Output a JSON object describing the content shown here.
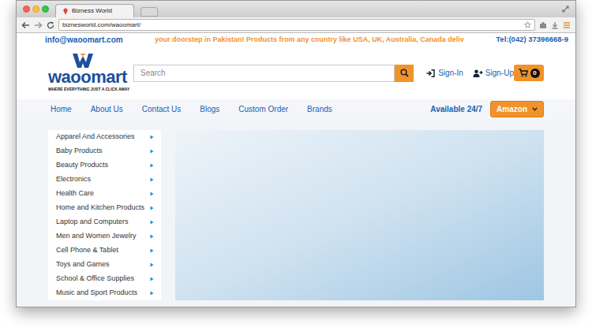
{
  "window": {
    "tab_title": "Bizness World",
    "url": "biznesworld.com/waoomart/"
  },
  "topbar": {
    "email": "info@waoomart.com",
    "marquee": "your doorstep in Pakistan! Products from any country like USA, UK, Australia, Canada deliv",
    "phone": "Tel:(042) 37396668-9"
  },
  "logo": {
    "name": "waoomart",
    "tagline": "WHERE EVERYTHING JUST A CLICK AWAY"
  },
  "search": {
    "placeholder": "Search"
  },
  "account": {
    "sign_in": "Sign-In",
    "sign_up": "Sign-Up",
    "cart_count": "0"
  },
  "nav": [
    {
      "label": "Home"
    },
    {
      "label": "About Us"
    },
    {
      "label": "Contact Us"
    },
    {
      "label": "Blogs"
    },
    {
      "label": "Custom Order"
    },
    {
      "label": "Brands"
    }
  ],
  "availability": "Available 24/7",
  "store_select": {
    "value": "Amazon"
  },
  "categories": [
    {
      "label": "Apparel And Accessories"
    },
    {
      "label": "Baby Products"
    },
    {
      "label": "Beauty Products"
    },
    {
      "label": "Electronics"
    },
    {
      "label": "Health Care"
    },
    {
      "label": "Home and Kitchen Products"
    },
    {
      "label": "Laptop and Computers"
    },
    {
      "label": "Men and Women Jewelry"
    },
    {
      "label": "Cell Phone & Tablet"
    },
    {
      "label": "Toys and Games"
    },
    {
      "label": "School & Office Supplies"
    },
    {
      "label": "Music and Sport Products"
    }
  ]
}
